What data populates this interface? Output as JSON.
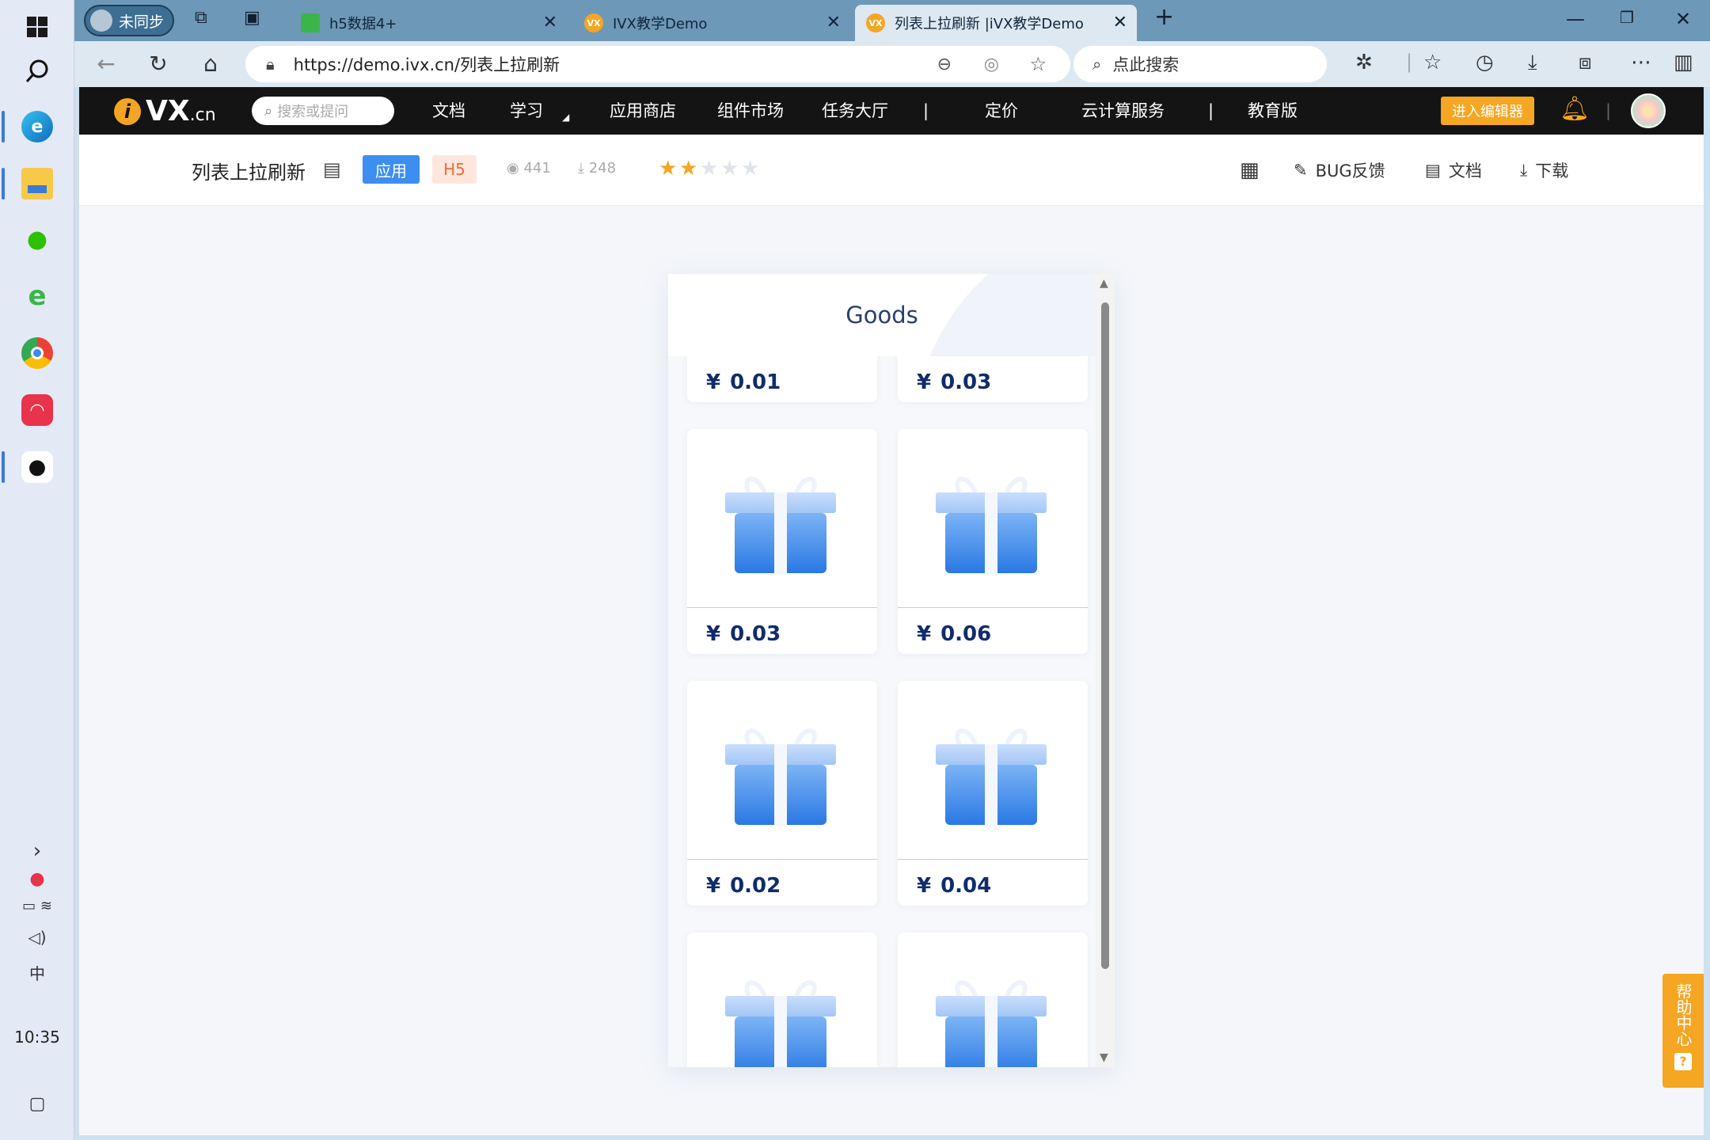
{
  "taskbar": {
    "clock": "10:35",
    "ime": "中"
  },
  "browser": {
    "profile_label": "未同步",
    "tabs": [
      {
        "title": "h5数据4+"
      },
      {
        "title": "IVX教学Demo",
        "favicon": "VX"
      },
      {
        "title": "列表上拉刷新 |iVX教学Demo",
        "favicon": "VX"
      }
    ],
    "url": "https://demo.ivx.cn/列表上拉刷新",
    "search_placeholder": "点此搜索"
  },
  "site": {
    "logo_main": "VX",
    "logo_dot": "i",
    "logo_suffix": ".cn",
    "search_placeholder": "搜索或提问",
    "nav": [
      "文档",
      "学习",
      "应用商店",
      "组件市场",
      "任务大厅",
      "定价",
      "云计算服务",
      "教育版"
    ],
    "enter_editor": "进入编辑器",
    "accent": "#f5a623"
  },
  "app": {
    "title": "列表上拉刷新",
    "tag_app": "应用",
    "tag_h5": "H5",
    "views": "441",
    "downloads": "248",
    "rating": 2,
    "rating_max": 5,
    "actions": {
      "bug": "BUG反馈",
      "doc": "文档",
      "download": "下载"
    }
  },
  "preview": {
    "heading": "Goods",
    "currency": "¥",
    "items": [
      {
        "price": "0.01"
      },
      {
        "price": "0.03"
      },
      {
        "price": "0.03"
      },
      {
        "price": "0.06"
      },
      {
        "price": "0.02"
      },
      {
        "price": "0.04"
      },
      {
        "price": ""
      },
      {
        "price": ""
      }
    ]
  },
  "help": {
    "label": "帮助中心",
    "icon": "?"
  }
}
